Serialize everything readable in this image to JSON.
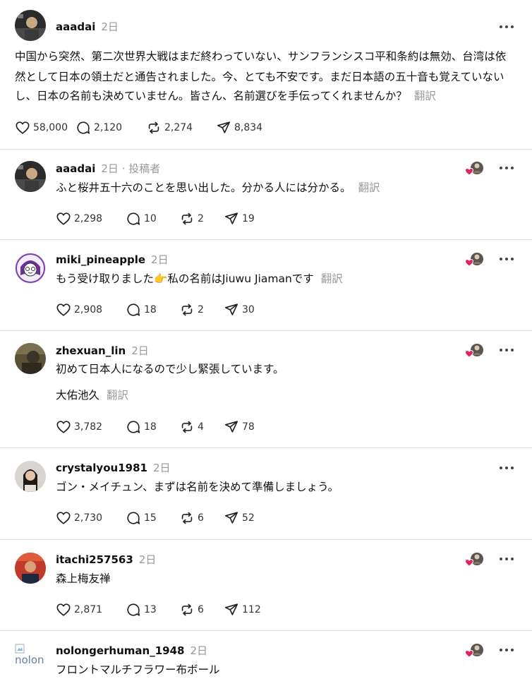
{
  "colors": {
    "divider": "#dedede",
    "muted": "#999999",
    "heart": "#e0245e",
    "text": "#101010"
  },
  "icons": {
    "like": "heart-icon",
    "reply": "comment-icon",
    "repost": "repost-icon",
    "share": "send-icon",
    "more": "more-dots-icon"
  },
  "main_post": {
    "username": "aaadai",
    "time": "2日",
    "text_lines": [
      "中国から突然、第二次世界大戦はまだ終わっていない、サンフランシスコ平和条約は無効、台湾は依",
      "然として日本の領土だと通告されました。今、とても不安です。まだ日本語の五十音も覚えていない",
      "し、日本の名前も決めていません。皆さん、名前選びを手伝ってくれませんか？"
    ],
    "translate": "翻訳",
    "likes": "58,000",
    "replies": "2,120",
    "reposts": "2,274",
    "shares": "8,834"
  },
  "replies": [
    {
      "username": "aaadai",
      "time": "2日",
      "author_tag": " · 投稿者",
      "text": "ふと桜井五十六のことを思い出した。分かる人には分かる。",
      "translate": "翻訳",
      "likes": "2,298",
      "replies": "10",
      "reposts": "2",
      "shares": "19"
    },
    {
      "username": "miki_pineapple",
      "time": "2日",
      "text_before_emoji": "もう受け取りました",
      "emoji": "👉",
      "text_after_emoji": "私の名前はJiuwu Jiamanです",
      "translate": "翻訳",
      "likes": "2,908",
      "replies": "18",
      "reposts": "2",
      "shares": "30"
    },
    {
      "username": "zhexuan_lin",
      "time": "2日",
      "text": "初めて日本人になるので少し緊張しています。",
      "text2": "大佑池久",
      "translate": "翻訳",
      "likes": "3,782",
      "replies": "18",
      "reposts": "4",
      "shares": "78"
    },
    {
      "username": "crystalyou1981",
      "time": "2日",
      "text": "ゴン・メイチュン、まずは名前を決めて準備しましょう。",
      "likes": "2,730",
      "replies": "15",
      "reposts": "6",
      "shares": "52"
    },
    {
      "username": "itachi257563",
      "time": "2日",
      "text": "森上梅友禅",
      "likes": "2,871",
      "replies": "13",
      "reposts": "6",
      "shares": "112"
    },
    {
      "username": "nolongerhuman_1948",
      "time": "2日",
      "avatar_alt": "nolon",
      "text": "フロントマルチフラワー布ボール"
    }
  ]
}
